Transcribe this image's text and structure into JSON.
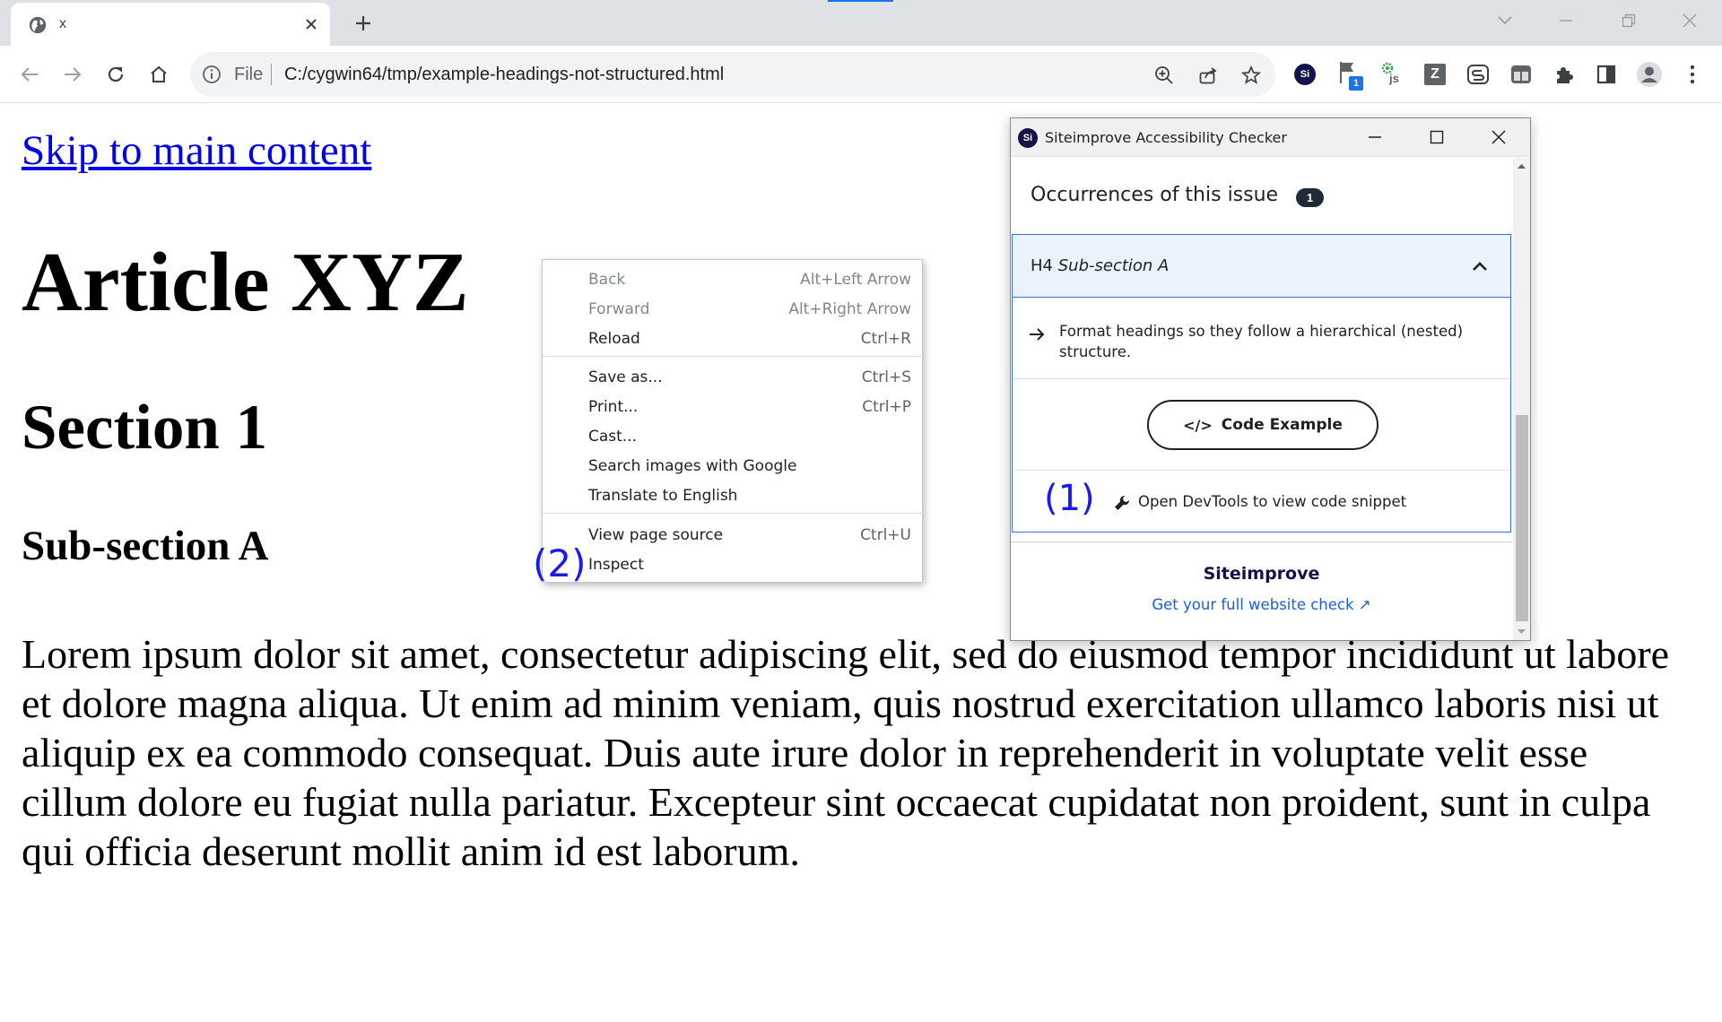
{
  "browser": {
    "tab_title": "x",
    "address": {
      "scheme_label": "File",
      "url": "C:/cygwin64/tmp/example-headings-not-structured.html"
    },
    "extensions": {
      "siteimprove_badge": "Si",
      "flag_badge": "1",
      "js_badge": "js",
      "z_badge": "Z"
    },
    "colors": {
      "tabstrip": "#dee1e6",
      "accent": "#1a73e8"
    }
  },
  "page": {
    "skip_link": "Skip to main content",
    "h1": "Article XYZ",
    "h2": "Section 1",
    "h4": "Sub-section A",
    "paragraph": "Lorem ipsum dolor sit amet, consectetur adipiscing elit, sed do eiusmod tempor incididunt ut labore et dolore magna aliqua. Ut enim ad minim veniam, quis nostrud exercitation ullamco laboris nisi ut aliquip ex ea commodo consequat. Duis aute irure dolor in reprehenderit in voluptate velit esse cillum dolore eu fugiat nulla pariatur. Excepteur sint occaecat cupidatat non proident, sunt in culpa qui officia deserunt mollit anim id est laborum."
  },
  "context_menu": {
    "items": [
      {
        "label": "Back",
        "shortcut": "Alt+Left Arrow"
      },
      {
        "label": "Forward",
        "shortcut": "Alt+Right Arrow"
      },
      {
        "label": "Reload",
        "shortcut": "Ctrl+R"
      },
      {
        "label": "Save as...",
        "shortcut": "Ctrl+S"
      },
      {
        "label": "Print...",
        "shortcut": "Ctrl+P"
      },
      {
        "label": "Cast...",
        "shortcut": ""
      },
      {
        "label": "Search images with Google",
        "shortcut": ""
      },
      {
        "label": "Translate to English",
        "shortcut": ""
      },
      {
        "label": "View page source",
        "shortcut": "Ctrl+U"
      },
      {
        "label": "Inspect",
        "shortcut": ""
      }
    ]
  },
  "annotations": {
    "one": "(1)",
    "two": "(2)"
  },
  "siteimprove": {
    "logo": "Si",
    "window_title": "Siteimprove Accessibility Checker",
    "occurrences_label": "Occurrences of this issue",
    "occurrences_count": "1",
    "issue": {
      "tag": "H4",
      "heading_text": "Sub-section A",
      "recommendation": "Format headings so they follow a hierarchical (nested) structure.",
      "code_button": "Code Example",
      "code_glyph": "</>",
      "devtools_text": "Open DevTools to view code snippet"
    },
    "brand": "Siteimprove",
    "full_check_link": "Get your full website check ↗",
    "colors": {
      "brand": "#13134a",
      "link": "#1a5fd6",
      "selected": "#3b6fd6",
      "selected_bg": "#eaf2fb"
    }
  }
}
